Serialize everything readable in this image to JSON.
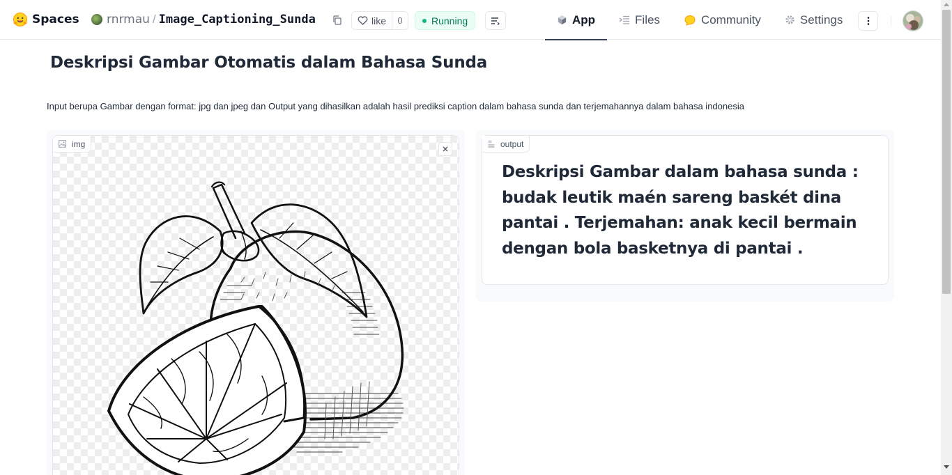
{
  "header": {
    "brand": "Spaces",
    "owner": "rnrmau",
    "separator": "/",
    "repo": "Image_Captioning_Sunda",
    "like_label": "like",
    "like_count": "0",
    "status": "Running",
    "tabs": [
      {
        "label": "App",
        "icon": "cube-icon",
        "active": true
      },
      {
        "label": "Files",
        "icon": "files-icon",
        "active": false
      },
      {
        "label": "Community",
        "icon": "community-icon",
        "active": false
      },
      {
        "label": "Settings",
        "icon": "gear-icon",
        "active": false
      }
    ]
  },
  "main": {
    "title": "Deskripsi Gambar Otomatis dalam Bahasa Sunda",
    "description": "Input berupa Gambar dengan format: jpg dan jpeg dan Output yang dihasilkan adalah hasil prediksi caption dalam bahasa sunda dan terjemahannya dalam bahasa indonesia",
    "input_label": "img",
    "output_label": "output",
    "output_text": "Deskripsi Gambar dalam bahasa sunda : budak leutik maén sareng baskét dina pantai . Terjemahan: anak kecil bermain dengan bola basketnya di pantai ."
  },
  "colors": {
    "status_green": "#047857",
    "status_bg": "#ecfdf5",
    "text": "#1f2937"
  }
}
